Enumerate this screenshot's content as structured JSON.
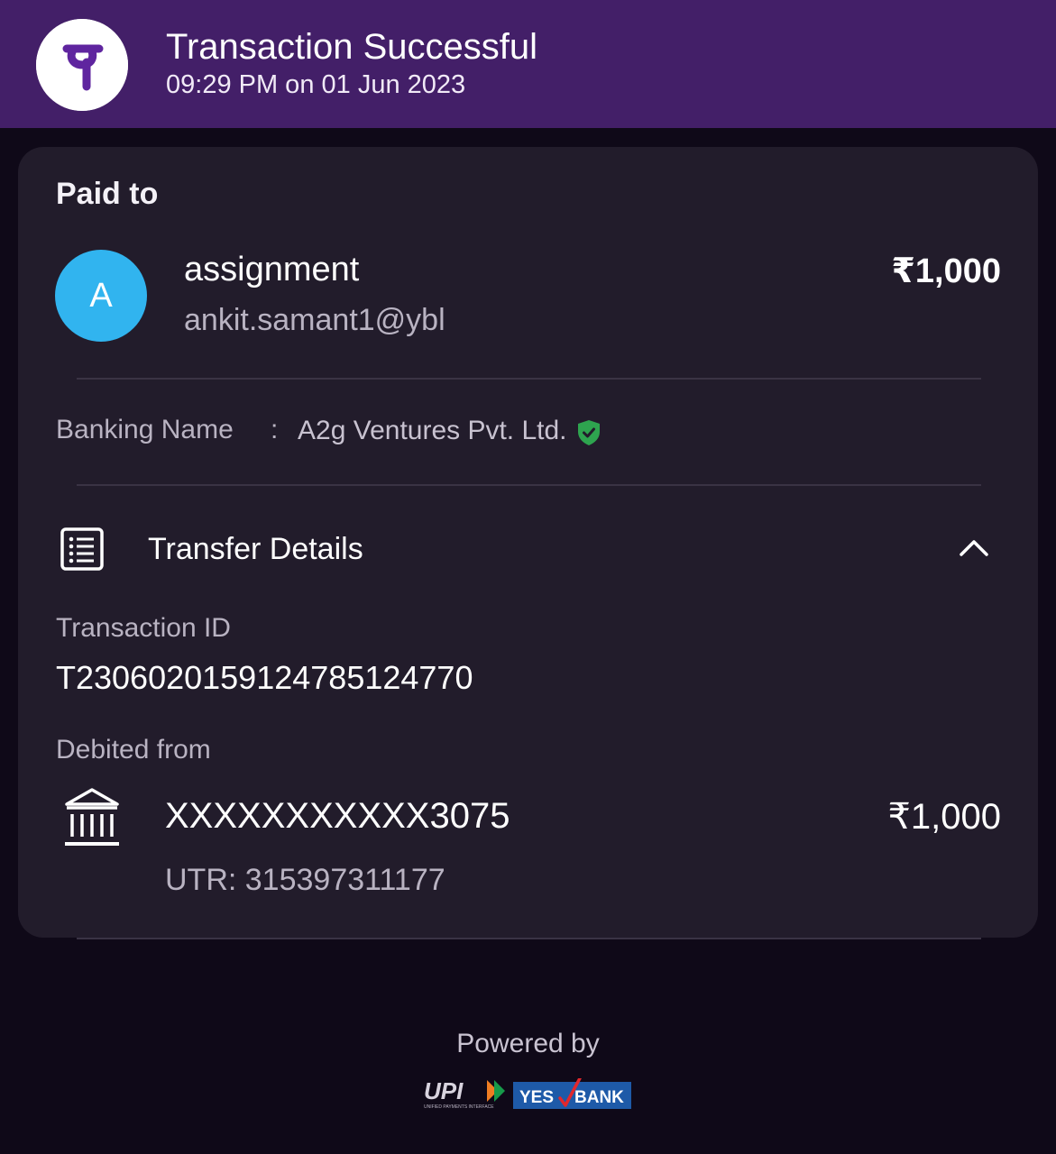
{
  "header": {
    "title": "Transaction Successful",
    "subtitle": "09:29 PM on 01 Jun 2023",
    "logo_letter": "पे",
    "logo_icon": "phonepe-logo",
    "background_color": "#431f68",
    "logo_color": "#5f259f"
  },
  "payee": {
    "section_label": "Paid to",
    "avatar_initial": "A",
    "avatar_color": "#31b4ef",
    "name": "assignment",
    "upi_id": "ankit.samant1@ybl",
    "amount": "₹1,000"
  },
  "banking_name": {
    "label": "Banking Name",
    "separator": ":",
    "value": "A2g Ventures Pvt. Ltd.",
    "verified_icon": "verified-shield-icon",
    "verified_color": "#2ea44f"
  },
  "transfer_details": {
    "title": "Transfer Details",
    "icon": "receipt-list-icon",
    "toggle_icon": "chevron-up-icon",
    "expanded": true,
    "transaction_id_label": "Transaction ID",
    "transaction_id": "T2306020159124785124770",
    "debited_from_label": "Debited from",
    "bank_icon": "bank-building-icon",
    "account_number": "XXXXXXXXXXX3075",
    "amount": "₹1,000",
    "utr": "UTR: 315397311177"
  },
  "footer": {
    "powered_by": "Powered by",
    "upi_logo_text": "UPI",
    "upi_tagline": "UNIFIED PAYMENTS INTERFACE",
    "bank_logo_left": "YES",
    "bank_logo_right": "BANK",
    "bank_logo_color": "#1e5aa8"
  }
}
